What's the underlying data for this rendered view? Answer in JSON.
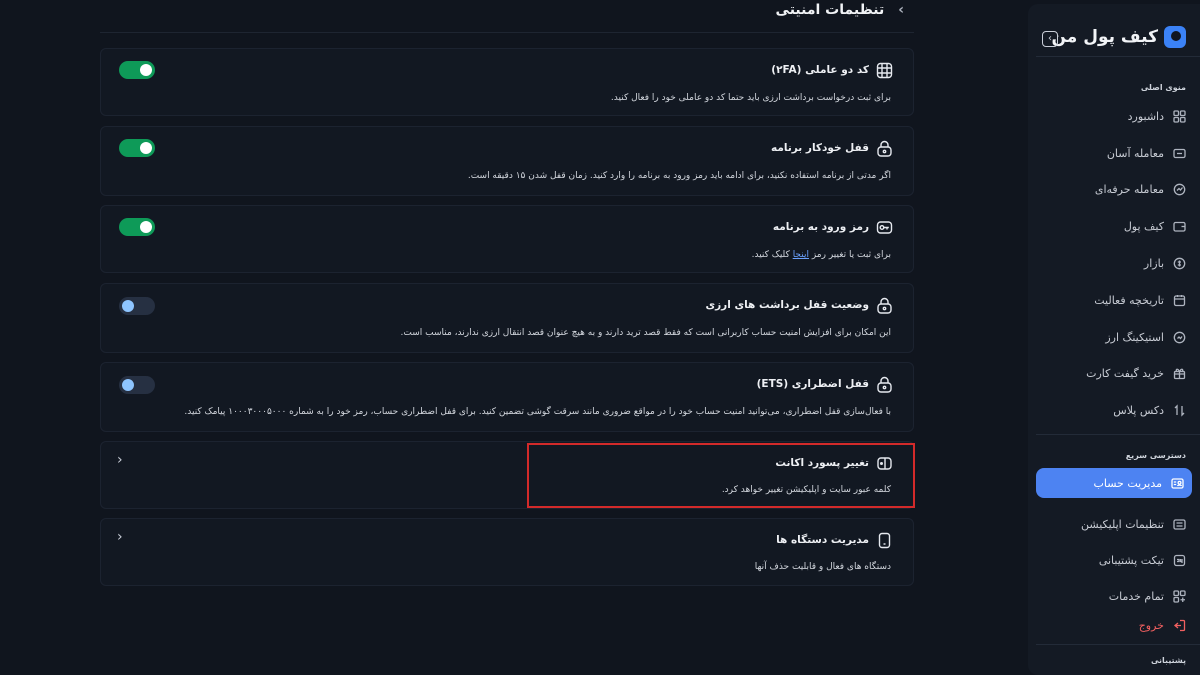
{
  "page": {
    "title": "تنظیمات امنیتی",
    "back_icon": "chevron-right-icon"
  },
  "sidebar": {
    "brand": "کیف پول من",
    "sections": {
      "main": "منوی اصلی",
      "quick": "دسترسی سریع",
      "support": "پشتیبانی"
    },
    "main_items": [
      {
        "label": "داشبورد",
        "icon": "dashboard-icon"
      },
      {
        "label": "معامله آسان",
        "icon": "easy-trade-icon"
      },
      {
        "label": "معامله حرفه‌ای",
        "icon": "pro-trade-icon"
      },
      {
        "label": "کیف پول",
        "icon": "wallet-icon"
      },
      {
        "label": "بازار",
        "icon": "market-icon"
      },
      {
        "label": "تاریخچه فعالیت",
        "icon": "history-icon"
      },
      {
        "label": "استیکینگ ارز",
        "icon": "staking-icon"
      },
      {
        "label": "خرید گیفت کارت",
        "icon": "gift-icon"
      },
      {
        "label": "دکس پلاس",
        "icon": "swap-icon"
      }
    ],
    "quick_items": [
      {
        "label": "مدیریت حساب",
        "icon": "account-icon",
        "active": true
      },
      {
        "label": "تنظیمات اپلیکیشن",
        "icon": "settings-icon"
      },
      {
        "label": "تیکت پشتیبانی",
        "icon": "ticket-icon"
      },
      {
        "label": "تمام خدمات",
        "icon": "grid-icon"
      }
    ],
    "logout": "خروج"
  },
  "cards": [
    {
      "title": "کد دو عاملی (۲FA)",
      "desc": "برای ثبت درخواست برداشت ارزی باید حتما کد دو عاملی خود را فعال کنید.",
      "icon": "two-factor-icon",
      "control": "toggle",
      "on": true
    },
    {
      "title": "قفل خودکار برنامه",
      "desc": "اگر مدتی از برنامه استفاده نکنید، برای ادامه باید رمز ورود به برنامه را وارد کنید. زمان قفل شدن ۱۵ دقیقه است.",
      "icon": "lock-icon",
      "control": "toggle",
      "on": true
    },
    {
      "title": "رمز ورود به برنامه",
      "desc_before": "برای ثبت یا تغییر رمز",
      "desc_link": "اینجا",
      "desc_after": "کلیک کنید.",
      "icon": "key-icon",
      "control": "toggle",
      "on": true
    },
    {
      "title": "وضعیت قفل برداشت های ارزی",
      "desc": "این امکان برای افزایش امنیت حساب کاربرانی است که فقط قصد ترید دارند و به هیچ عنوان قصد انتقال ارزی ندارند، مناسب است.",
      "icon": "lock-icon",
      "control": "toggle",
      "on": false
    },
    {
      "title": "قفل اضطراری (ETS)",
      "desc": "با فعال‌سازی قفل اضطراری، می‌توانید امنیت حساب خود را در مواقع ضروری مانند سرقت گوشی تضمین کنید. برای قفل اضطراری حساب، رمز خود را به شماره ۱۰۰۰۳۰۰۰۵۰۰۰ پیامک کنید.",
      "icon": "lock-icon",
      "control": "toggle",
      "on": false
    },
    {
      "title": "تغییر پسورد اکانت",
      "desc": "کلمه عبور سایت و اپلیکیشن تغییر خواهد کرد.",
      "icon": "password-icon",
      "control": "chevron"
    },
    {
      "title": "مدیریت دستگاه ها",
      "desc": "دستگاه های فعال و قابلیت حذف آنها",
      "icon": "device-icon",
      "control": "chevron"
    }
  ]
}
